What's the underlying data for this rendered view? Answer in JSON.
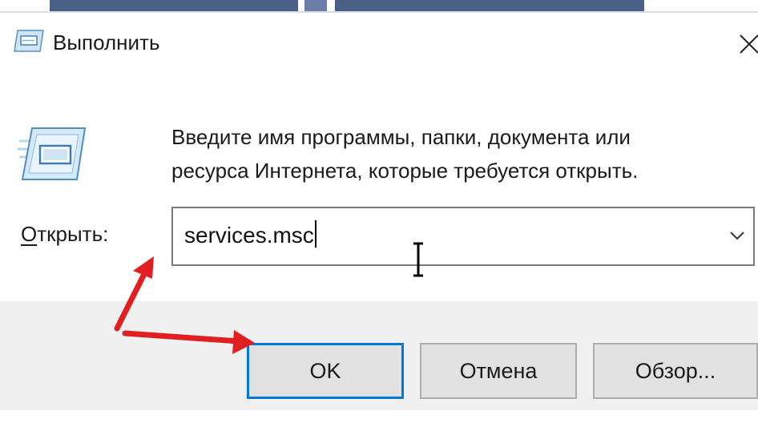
{
  "dialog": {
    "title": "Выполнить",
    "title_icon": "run-icon",
    "close_icon": "close-icon",
    "big_icon": "run-icon",
    "description_line1": "Введите имя программы, папки, документа или",
    "description_line2": "ресурса Интернета, которые требуется открыть.",
    "open_label_accel": "О",
    "open_label_rest": "ткрыть:",
    "open_value": "services.msc",
    "dropdown_icon": "chevron-down-icon",
    "cursor_icon": "text-cursor-icon"
  },
  "buttons": {
    "ok_label": "OK",
    "cancel_label": "Отмена",
    "browse_label": "Обзор..."
  },
  "annotations": {
    "arrow_color": "#e02020"
  },
  "colors": {
    "accent": "#0078d7",
    "footer_bg": "#f0f0f0",
    "button_bg": "#e1e1e1"
  }
}
